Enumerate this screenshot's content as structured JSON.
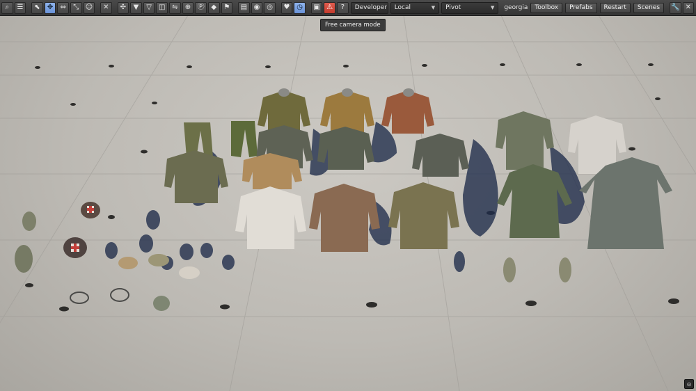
{
  "toolbar": {
    "icons": [
      "search-icon",
      "menu-icon",
      "select-icon",
      "move-icon",
      "rotate-icon",
      "scale-icon",
      "smiley-icon",
      "cross-tool-icon",
      "navmesh-icon",
      "triangle-down-icon",
      "triangle-outline-icon",
      "split-view-icon",
      "link-icon",
      "target-icon",
      "pin-p-icon",
      "diamond-icon",
      "flag-icon",
      "document-icon",
      "eye-icon",
      "eye-off-icon",
      "heart-icon",
      "clock-icon",
      "save-icon",
      "warning-icon",
      "help-icon"
    ],
    "developer_label": "Developer",
    "local_label": "Local",
    "pivot_label": "Pivot",
    "username": "georgia",
    "toolbox_label": "Toolbox",
    "prefabs_label": "Prefabs",
    "restart_label": "Restart",
    "scenes_label": "Scenes"
  },
  "tooltip": {
    "text": "Free camera mode"
  },
  "colors": {
    "toolbar_bg": "#3f3f3f",
    "active_blue": "#7aa2e3",
    "warning_red": "#d8493b",
    "ground": "#c3c0ba"
  }
}
